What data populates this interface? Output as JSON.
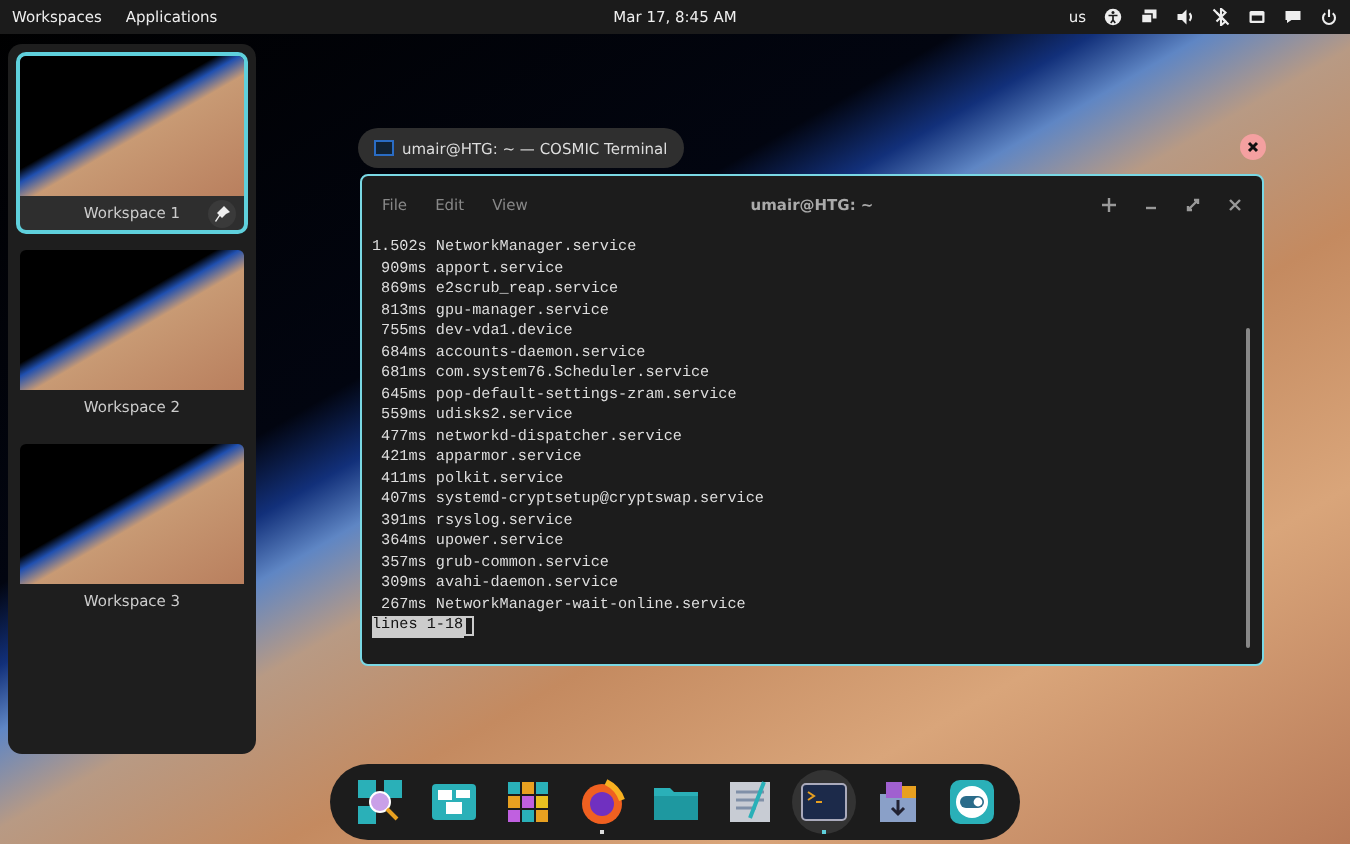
{
  "top_bar": {
    "menus": [
      "Workspaces",
      "Applications"
    ],
    "clock": "Mar 17, 8:45 AM",
    "keyboard_layout": "us"
  },
  "workspaces": [
    {
      "label": "Workspace 1",
      "selected": true
    },
    {
      "label": "Workspace 2",
      "selected": false
    },
    {
      "label": "Workspace 3",
      "selected": false
    }
  ],
  "window_label": {
    "title": "umair@HTG: ~ — COSMIC Terminal"
  },
  "terminal": {
    "menus": [
      "File",
      "Edit",
      "View"
    ],
    "title": "umair@HTG: ~",
    "lines": [
      "1.502s NetworkManager.service",
      " 909ms apport.service",
      " 869ms e2scrub_reap.service",
      " 813ms gpu-manager.service",
      " 755ms dev-vda1.device",
      " 684ms accounts-daemon.service",
      " 681ms com.system76.Scheduler.service",
      " 645ms pop-default-settings-zram.service",
      " 559ms udisks2.service",
      " 477ms networkd-dispatcher.service",
      " 421ms apparmor.service",
      " 411ms polkit.service",
      " 407ms systemd-cryptsetup@cryptswap.service",
      " 391ms rsyslog.service",
      " 364ms upower.service",
      " 357ms grub-common.service",
      " 309ms avahi-daemon.service",
      " 267ms NetworkManager-wait-online.service"
    ],
    "status": "lines 1-18"
  },
  "dock": [
    {
      "running": false,
      "selected": false
    },
    {
      "running": false,
      "selected": false
    },
    {
      "running": false,
      "selected": false
    },
    {
      "running": true,
      "selected": false
    },
    {
      "running": false,
      "selected": false
    },
    {
      "running": false,
      "selected": false
    },
    {
      "running": true,
      "selected": true
    },
    {
      "running": false,
      "selected": false
    },
    {
      "running": false,
      "selected": false
    }
  ]
}
